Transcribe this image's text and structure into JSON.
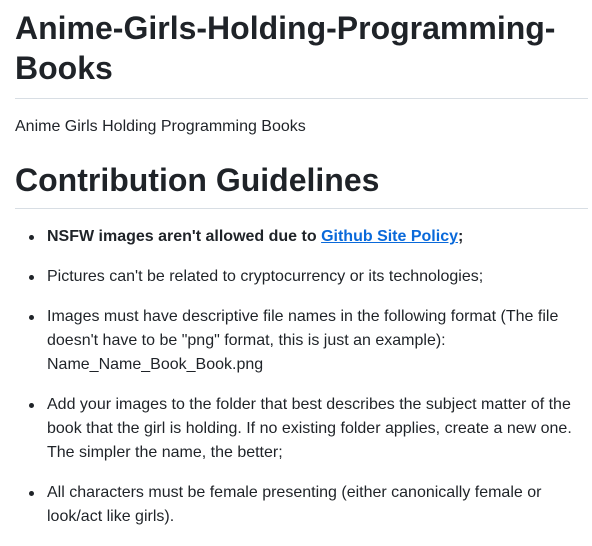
{
  "header": {
    "title": "Anime-Girls-Holding-Programming-Books",
    "description": "Anime Girls Holding Programming Books"
  },
  "contribution": {
    "heading": "Contribution Guidelines",
    "rules": {
      "nsfw_prefix": "NSFW images aren't allowed due to ",
      "nsfw_link": "Github Site Policy",
      "nsfw_suffix": ";",
      "crypto": "Pictures can't be related to cryptocurrency or its technologies;",
      "file_names": "Images must have descriptive file names in the following format (The file doesn't have to be \"png\" format, this is just an example): Name_Name_Book_Book.png",
      "folders": "Add your images to the folder that best describes the subject matter of the book that the girl is holding. If no existing folder applies, create a new one. The simpler the name, the better;",
      "characters": "All characters must be female presenting (either canonically female or look/act like girls)."
    }
  },
  "colors": {
    "text": "#1f2328",
    "link": "#0969da",
    "divider": "#d8dee4",
    "background": "#ffffff"
  }
}
